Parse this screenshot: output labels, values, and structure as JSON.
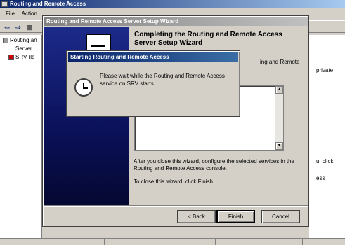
{
  "mmc": {
    "title": "Routing and Remote Access",
    "menu": [
      "File",
      "Action"
    ],
    "tree": [
      {
        "label": "Routing an"
      },
      {
        "label": "Server"
      },
      {
        "label": "SRV (lc"
      }
    ],
    "right_fragments": [
      "private",
      "u, click",
      "ess"
    ]
  },
  "wizard": {
    "title": "Routing and Remote Access Server Setup Wizard",
    "heading": "Completing the Routing and Remote Access Server Setup Wizard",
    "body_fragment": "ing and Remote",
    "after_close": "After you close this wizard, configure the selected services in the Routing and  Remote Access console.",
    "finish_text": "To close this wizard, click Finish.",
    "buttons": {
      "back": "< Back",
      "finish": "Finish",
      "cancel": "Cancel"
    }
  },
  "dialog": {
    "title": "Starting Routing and Remote Access",
    "message": "Please wait while the Routing and Remote Access service on SRV starts."
  }
}
